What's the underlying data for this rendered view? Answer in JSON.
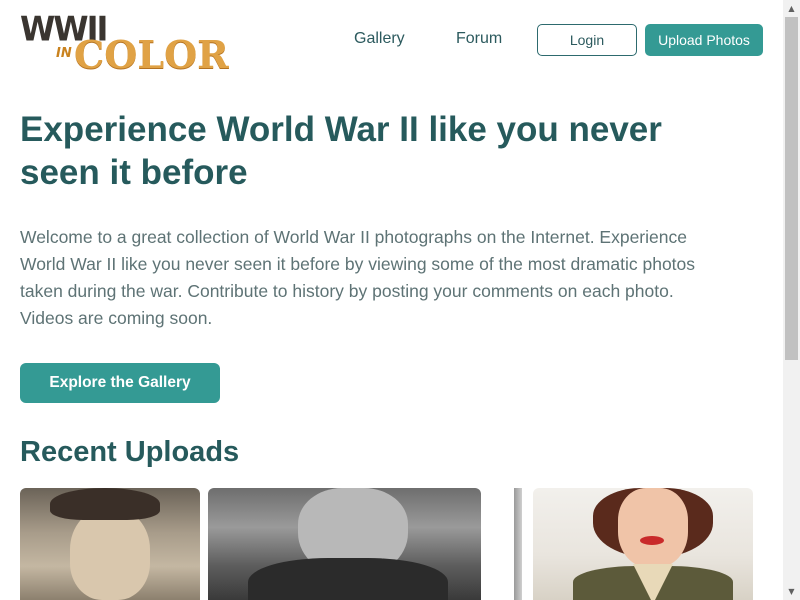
{
  "logo": {
    "line1": "WWII",
    "line2": "IN",
    "line3": "COLOR",
    "icon": "wwii-in-color-logo"
  },
  "nav": {
    "gallery_label": "Gallery",
    "forum_label": "Forum",
    "login_label": "Login",
    "upload_label": "Upload Photos"
  },
  "hero": {
    "title": "Experience World War II like you never seen it before",
    "description": "Welcome to a great collection of World War II photographs on the Internet. Experience World War II like you never seen it before by viewing some of the most dramatic photos taken during the war. Contribute to history by posting your comments on each photo. Videos are coming soon.",
    "cta_label": "Explore the Gallery"
  },
  "recent": {
    "title": "Recent Uploads"
  },
  "colors": {
    "accent": "#349a94",
    "heading": "#265a5c",
    "body_text": "#5e7375"
  },
  "scrollbar": {
    "up_icon": "▲",
    "down_icon": "▼"
  }
}
